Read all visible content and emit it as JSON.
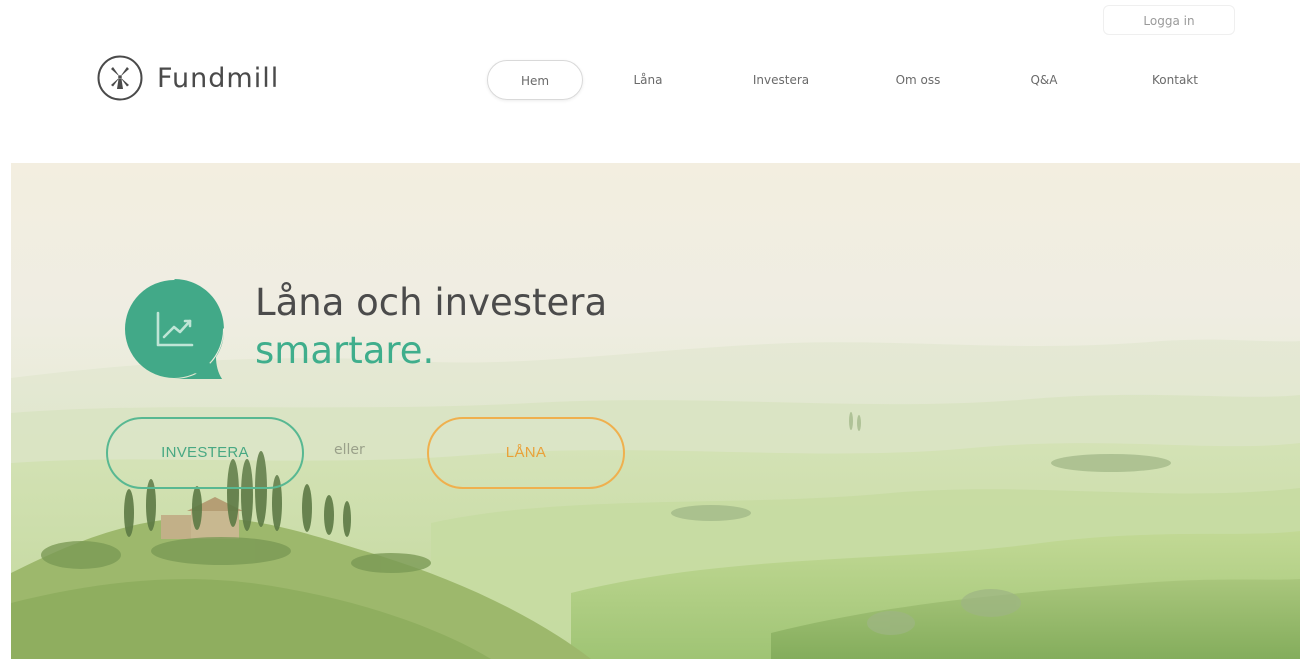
{
  "header": {
    "brand": "Fundmill",
    "login_label": "Logga in",
    "nav": [
      "Hem",
      "Låna",
      "Investera",
      "Om oss",
      "Q&A",
      "Kontakt"
    ],
    "active_nav": "Hem"
  },
  "hero": {
    "headline": "Låna och investera",
    "headline_accent": "smartare.",
    "invest_button": "INVESTERA",
    "or_text": "eller",
    "borrow_button": "LÅNA"
  },
  "colors": {
    "accent_green": "#3fae8c",
    "accent_orange": "#efb04e",
    "text_dark": "#4b4b4b"
  },
  "icons": {
    "logo": "windmill-icon",
    "bubble": "growth-chart-icon"
  }
}
